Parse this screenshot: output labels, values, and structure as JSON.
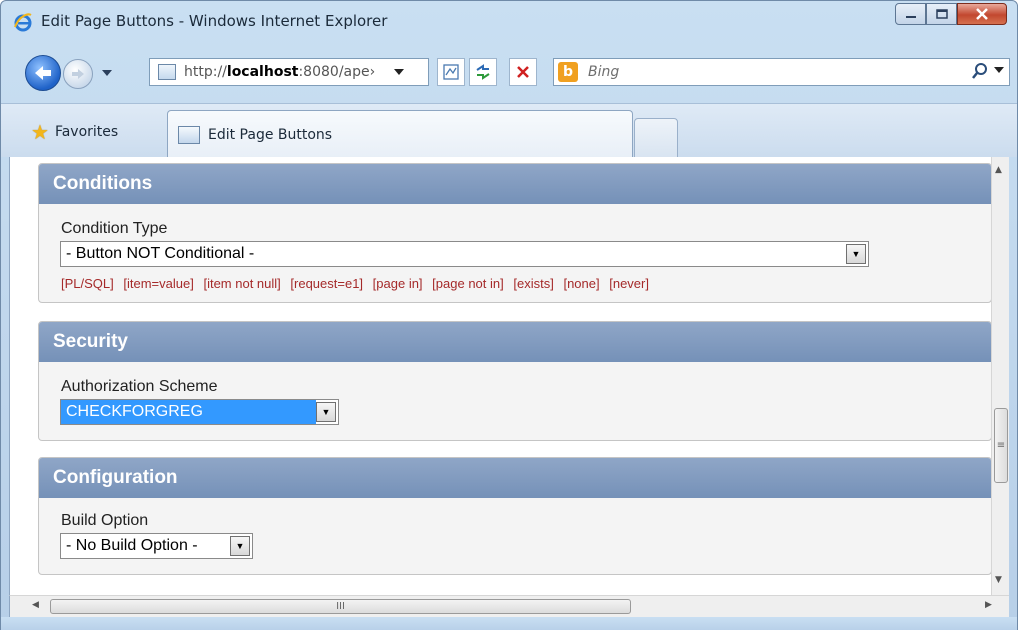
{
  "window": {
    "title": "Edit Page Buttons - Windows Internet Explorer"
  },
  "nav": {
    "url_prefix": "http://",
    "url_host": "localhost",
    "url_suffix": ":8080/ape›",
    "search_placeholder": "Bing"
  },
  "favorites": {
    "label": "Favorites"
  },
  "tab": {
    "label": "Edit Page Buttons"
  },
  "conditions": {
    "title": "Conditions",
    "field_label": "Condition Type",
    "selected": "- Button NOT Conditional -",
    "shortcuts": [
      "[PL/SQL]",
      "[item=value]",
      "[item not null]",
      "[request=e1]",
      "[page in]",
      "[page not in]",
      "[exists]",
      "[none]",
      "[never]"
    ]
  },
  "security": {
    "title": "Security",
    "field_label": "Authorization Scheme",
    "selected": "CHECKFORGREG"
  },
  "configuration": {
    "title": "Configuration",
    "field_label": "Build Option",
    "selected": "- No Build Option -"
  },
  "scrollbar_glyphs": {
    "v_thumb": "≡",
    "h_thumb": "III"
  },
  "colors": {
    "region_header": "#7f9bc0",
    "shortcut_link": "#a52a2a",
    "selection": "#3399ff"
  }
}
